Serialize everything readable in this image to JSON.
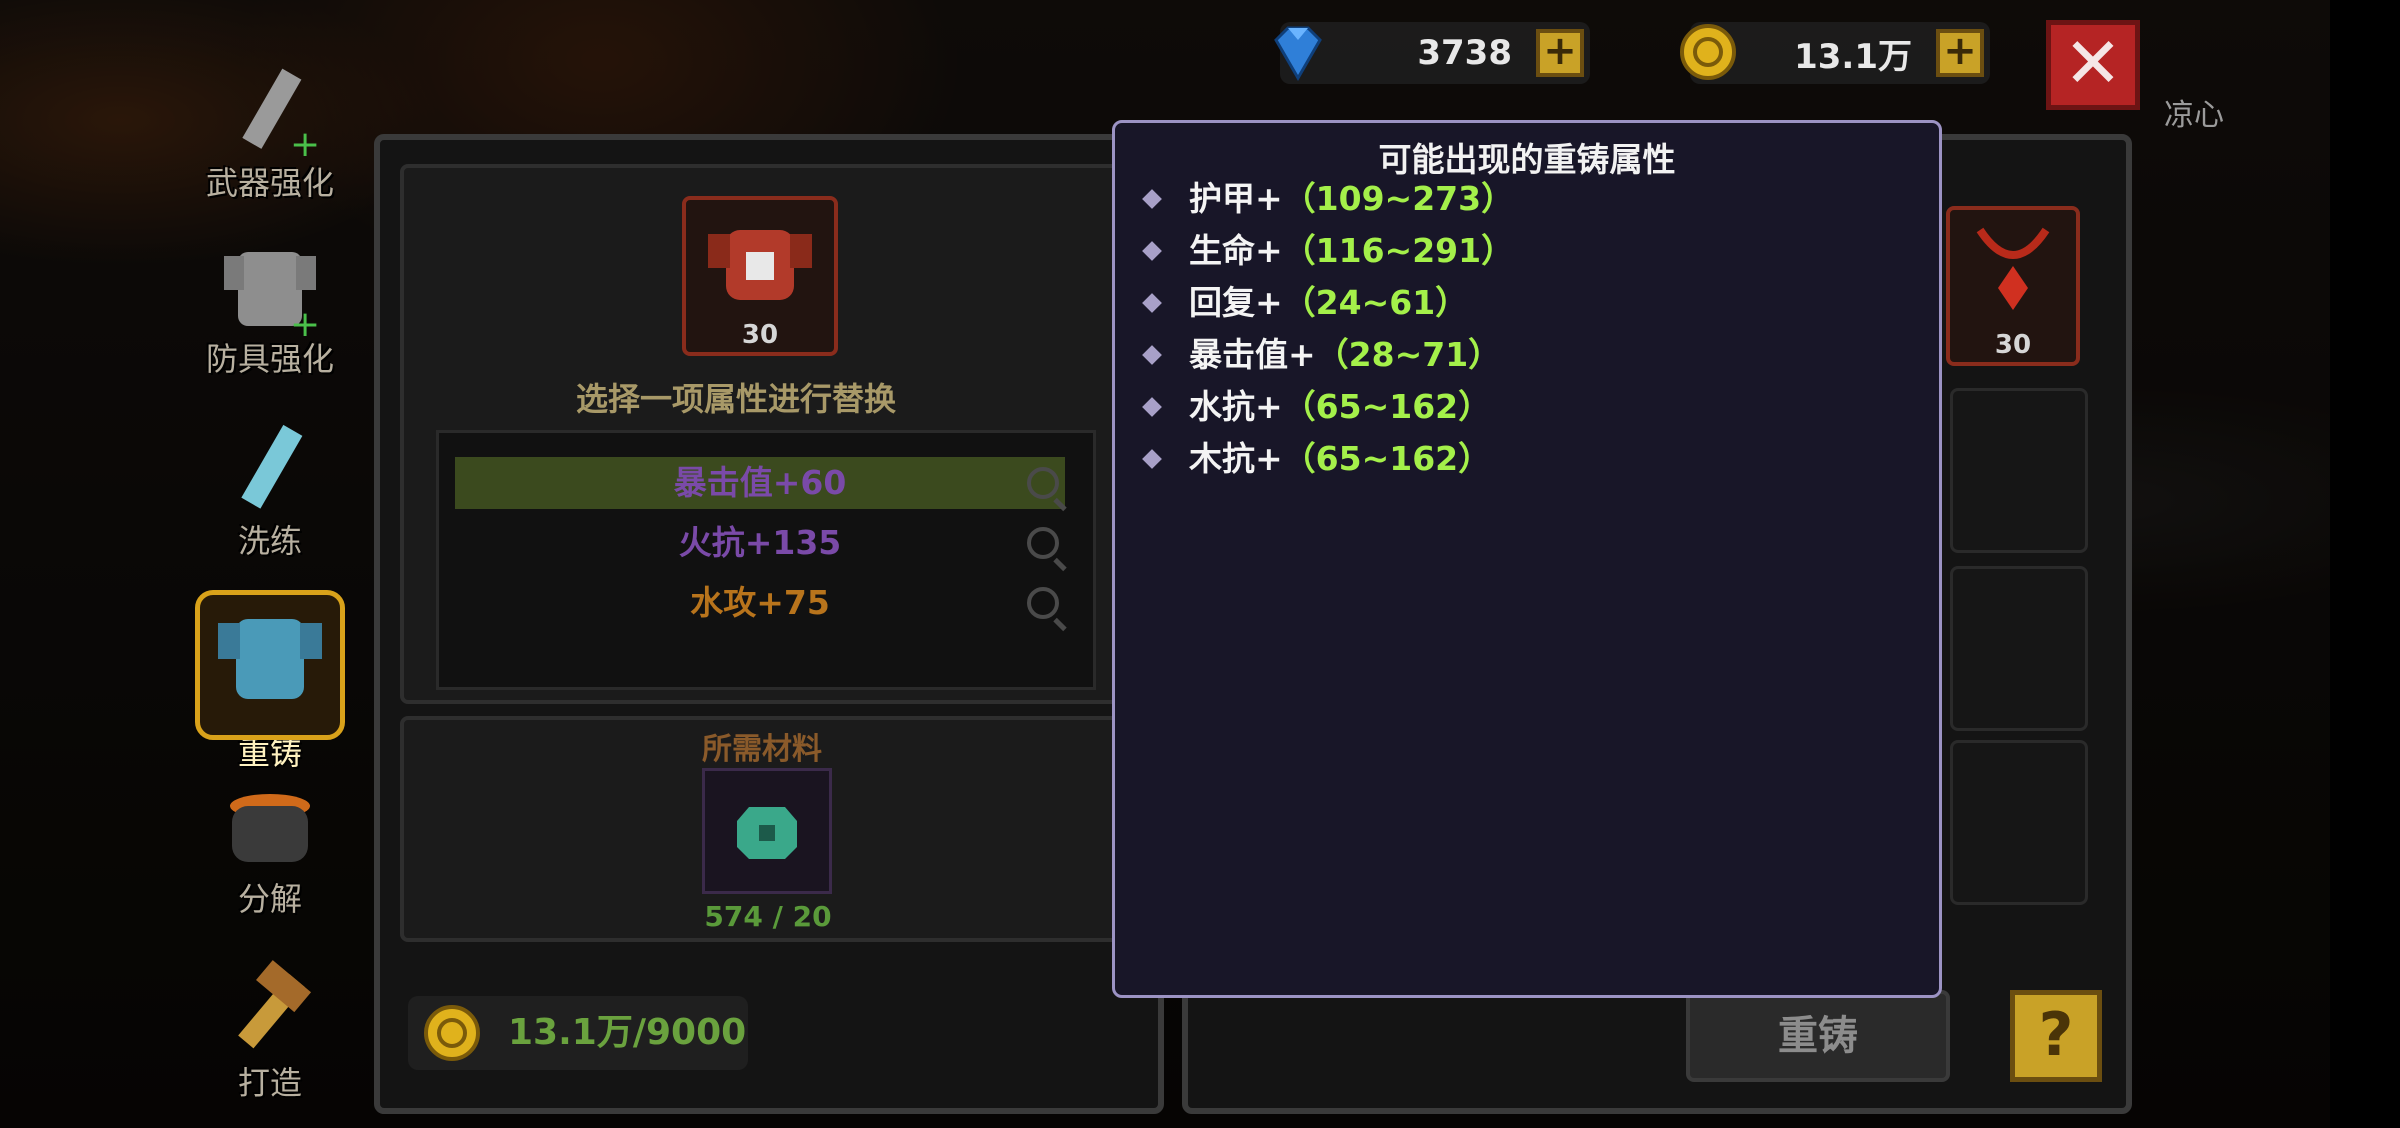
{
  "currencies": {
    "gems": "3738",
    "coins": "13.1万",
    "plus_label": "+"
  },
  "close_label": "✕",
  "user_name": "凉心",
  "nav": [
    {
      "label": "武器强化",
      "icon": "sword-upgrade-icon"
    },
    {
      "label": "防具强化",
      "icon": "armor-upgrade-icon"
    },
    {
      "label": "洗练",
      "icon": "refine-sword-icon"
    },
    {
      "label": "重铸",
      "icon": "reforge-armor-icon",
      "active": true
    },
    {
      "label": "分解",
      "icon": "cauldron-icon"
    },
    {
      "label": "打造",
      "icon": "hammer-icon"
    }
  ],
  "left_panel": {
    "equip_level": "30",
    "select_hint": "选择一项属性进行替换",
    "attributes": [
      {
        "text": "暴击值+60",
        "color": "#7a4aa8",
        "selected": true
      },
      {
        "text": "火抗+135",
        "color": "#7a4aa8",
        "selected": false
      },
      {
        "text": "水攻+75",
        "color": "#b8741c",
        "selected": false
      }
    ],
    "materials_label": "所需材料",
    "material_count": "574 / 20",
    "cost": "13.1万/9000"
  },
  "right_panel": {
    "equip_level": "30",
    "reforge_label": "重铸",
    "help_label": "?"
  },
  "popup": {
    "title": "可能出现的重铸属性",
    "rows": [
      {
        "name": "护甲+",
        "range": "（109~273）"
      },
      {
        "name": "生命+",
        "range": "（116~291）"
      },
      {
        "name": "回复+",
        "range": "（24~61）"
      },
      {
        "name": "暴击值+",
        "range": "（28~71）"
      },
      {
        "name": "水抗+",
        "range": "（65~162）"
      },
      {
        "name": "木抗+",
        "range": "（65~162）"
      }
    ]
  },
  "colors": {
    "accent_gold": "#c9a227",
    "close_red": "#b52424",
    "range_green": "#a4f04a",
    "popup_border": "#9c93c4"
  }
}
